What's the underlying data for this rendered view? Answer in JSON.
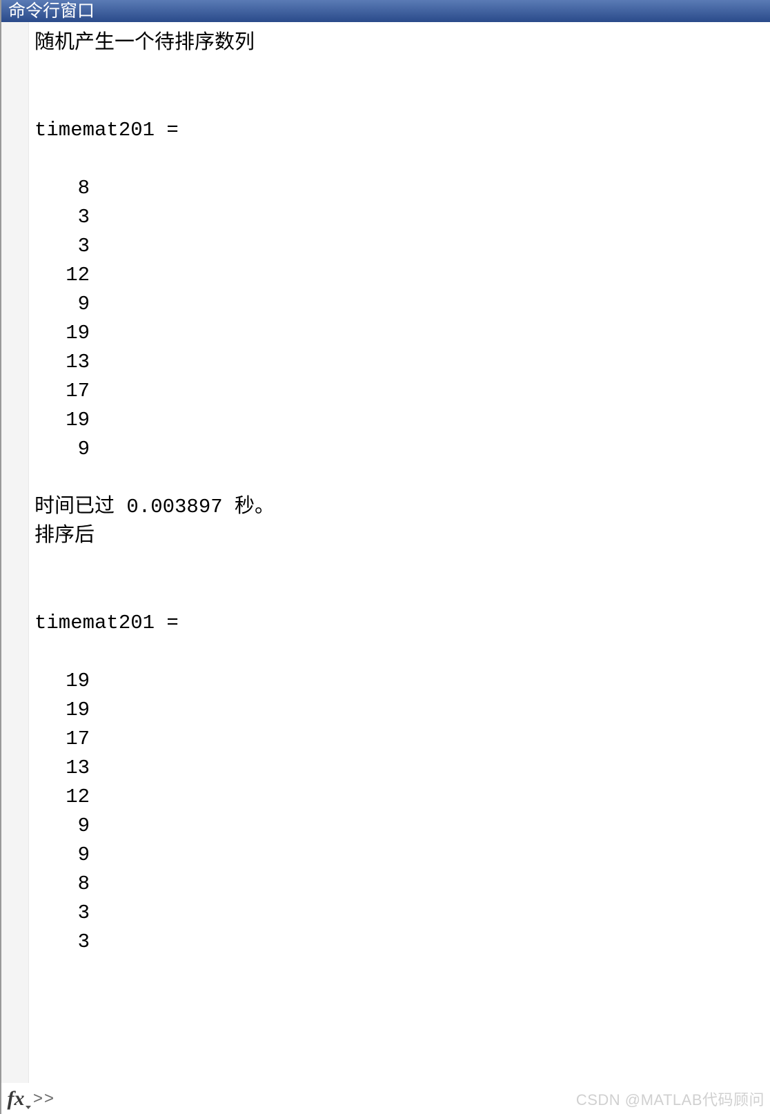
{
  "title": "命令行窗口",
  "output": {
    "line_random": "随机产生一个待排序数列",
    "blank": "",
    "var_header_1": "timemat201 =",
    "values_before": [
      "8",
      "3",
      "3",
      "12",
      "9",
      "19",
      "13",
      "17",
      "19",
      "9"
    ],
    "elapsed": "时间已过 0.003897 秒。",
    "after_sort": "排序后",
    "var_header_2": "timemat201 =",
    "values_after": [
      "19",
      "19",
      "17",
      "13",
      "12",
      "9",
      "9",
      "8",
      "3",
      "3"
    ]
  },
  "prompt": {
    "fx_label": "fx",
    "chevrons": ">>"
  },
  "watermark": "CSDN @MATLAB代码顾问"
}
